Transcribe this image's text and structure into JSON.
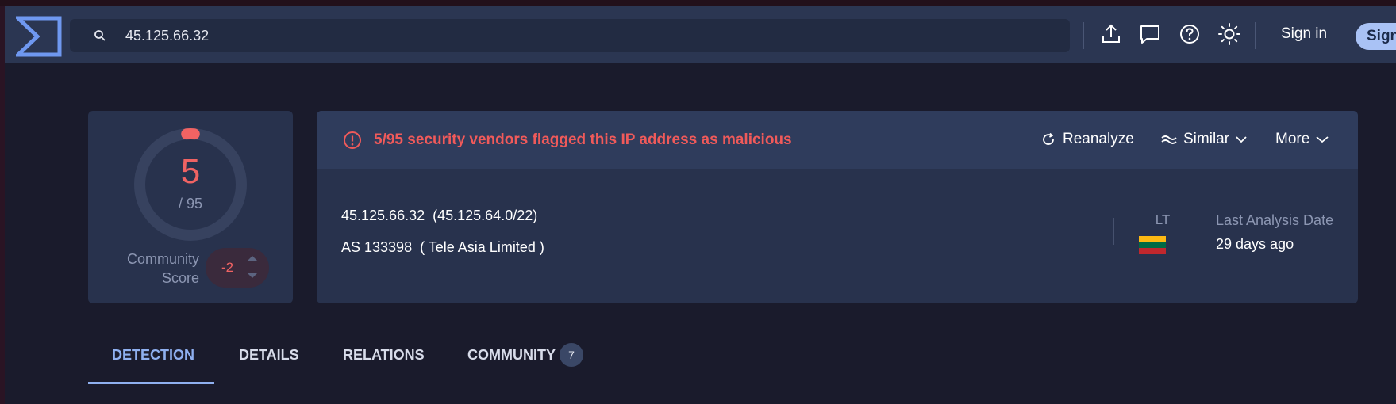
{
  "header": {
    "search_value": "45.125.66.32",
    "icons": [
      "upload-icon",
      "chat-icon",
      "help-icon",
      "theme-icon"
    ],
    "sign_in": "Sign in",
    "sign_up": "Sign"
  },
  "score": {
    "detections": "5",
    "total": "/ 95",
    "detection_fraction": 0.0526,
    "community_label": "Community Score",
    "community_value": "-2"
  },
  "report": {
    "alert": "5/95 security vendors flagged this IP address as malicious",
    "actions": {
      "reanalyze": "Reanalyze",
      "similar": "Similar",
      "more": "More"
    },
    "ip": "45.125.66.32",
    "network": "(45.125.64.0/22)",
    "asn": "AS 133398",
    "as_owner": "( Tele Asia Limited )",
    "country_code": "LT",
    "flag_colors": [
      "#fdb913",
      "#006a44",
      "#c1272d"
    ],
    "last_analysis_label": "Last Analysis Date",
    "last_analysis_value": "29 days ago"
  },
  "tabs": [
    {
      "label": "DETECTION",
      "active": true
    },
    {
      "label": "DETAILS",
      "active": false
    },
    {
      "label": "RELATIONS",
      "active": false
    },
    {
      "label": "COMMUNITY",
      "active": false,
      "badge": "7"
    }
  ],
  "colors": {
    "accent": "#8fb0f0",
    "danger": "#f05a5a",
    "header_bg": "#2b3652",
    "card_bg": "#28324d"
  }
}
